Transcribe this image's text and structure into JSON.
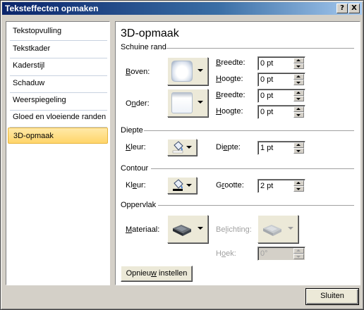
{
  "window": {
    "title": "Teksteffecten opmaken",
    "help_glyph": "?",
    "close_glyph": "X"
  },
  "sidebar": {
    "items": [
      {
        "label": "Tekstopvulling"
      },
      {
        "label": "Tekstkader"
      },
      {
        "label": "Kaderstijl"
      },
      {
        "label": "Schaduw"
      },
      {
        "label": "Weerspiegeling"
      },
      {
        "label": "Gloed en vloeiende randen"
      },
      {
        "label": "3D-opmaak",
        "selected": true
      }
    ]
  },
  "panel": {
    "title": "3D-opmaak",
    "bevel": {
      "section": "Schuine rand",
      "top_label": "Boven:",
      "top_icon": "bevel-top-icon",
      "bottom_label": "Onder:",
      "bottom_icon": "bevel-bottom-icon",
      "top_width_label": "Breedte:",
      "top_width_value": "0 pt",
      "top_height_label": "Hoogte:",
      "top_height_value": "0 pt",
      "bottom_width_label": "Breedte:",
      "bottom_width_value": "0 pt",
      "bottom_height_label": "Hoogte:",
      "bottom_height_value": "0 pt"
    },
    "depth": {
      "section": "Diepte",
      "color_label": "Kleur:",
      "color_icon": "paint-bucket-icon",
      "depth_label": "Diepte:",
      "depth_value": "1 pt"
    },
    "contour": {
      "section": "Contour",
      "color_label": "Kleur:",
      "color_icon": "paint-bucket-icon",
      "size_label": "Grootte:",
      "size_value": "2 pt"
    },
    "surface": {
      "section": "Oppervlak",
      "material_label": "Materiaal:",
      "material_icon": "material-icon",
      "lighting_label": "Belichting:",
      "lighting_icon": "lighting-icon",
      "angle_label": "Hoek:",
      "angle_value": "0°"
    },
    "reset_label": "Opnieuw instellen"
  },
  "footer": {
    "close_label": "Sluiten"
  },
  "colors": {
    "titlebar_start": "#0a246a",
    "selected_item": "#ffd56a",
    "depth_swatch": "#ffffff",
    "contour_swatch": "#000000"
  }
}
